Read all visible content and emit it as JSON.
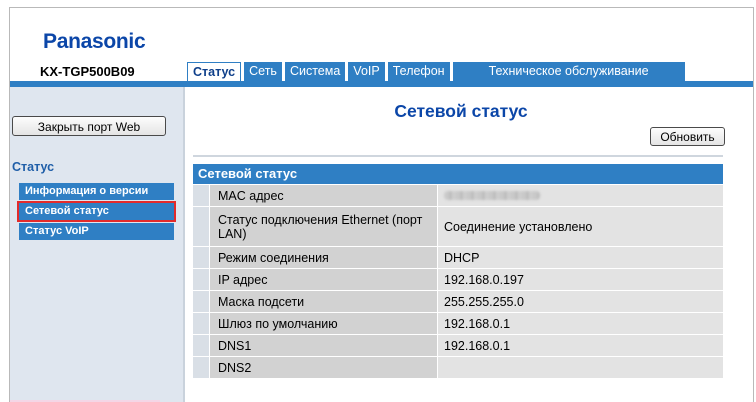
{
  "header": {
    "brand": "Panasonic",
    "model": "KX-TGP500B09"
  },
  "tabs": [
    {
      "label": "Статус",
      "active": true
    },
    {
      "label": "Сеть",
      "active": false
    },
    {
      "label": "Система",
      "active": false
    },
    {
      "label": "VoIP",
      "active": false
    },
    {
      "label": "Телефон",
      "active": false
    },
    {
      "label": "Техническое обслуживание",
      "active": false
    }
  ],
  "sidebar": {
    "close_button": "Закрыть порт Web",
    "section_title": "Статус",
    "items": [
      {
        "label": "Информация о версии",
        "selected": false
      },
      {
        "label": "Сетевой статус",
        "selected": true
      },
      {
        "label": "Статус VoIP",
        "selected": false
      }
    ]
  },
  "main": {
    "title": "Сетевой статус",
    "refresh_button": "Обновить",
    "table_title": "Сетевой статус",
    "rows": [
      {
        "label": "MAC адрес",
        "value": ""
      },
      {
        "label": "Статус подключения Ethernet (порт LAN)",
        "value": "Соединение установлено"
      },
      {
        "label": "Режим соединения",
        "value": "DHCP"
      },
      {
        "label": "IP адрес",
        "value": "192.168.0.197"
      },
      {
        "label": "Маска подсети",
        "value": "255.255.255.0"
      },
      {
        "label": "Шлюз по умолчанию",
        "value": "192.168.0.1"
      },
      {
        "label": "DNS1",
        "value": "192.168.0.1"
      },
      {
        "label": "DNS2",
        "value": ""
      }
    ]
  },
  "colors": {
    "accent": "#2f7fc4",
    "brand": "#0b46a8",
    "highlight": "#e32b2b"
  }
}
